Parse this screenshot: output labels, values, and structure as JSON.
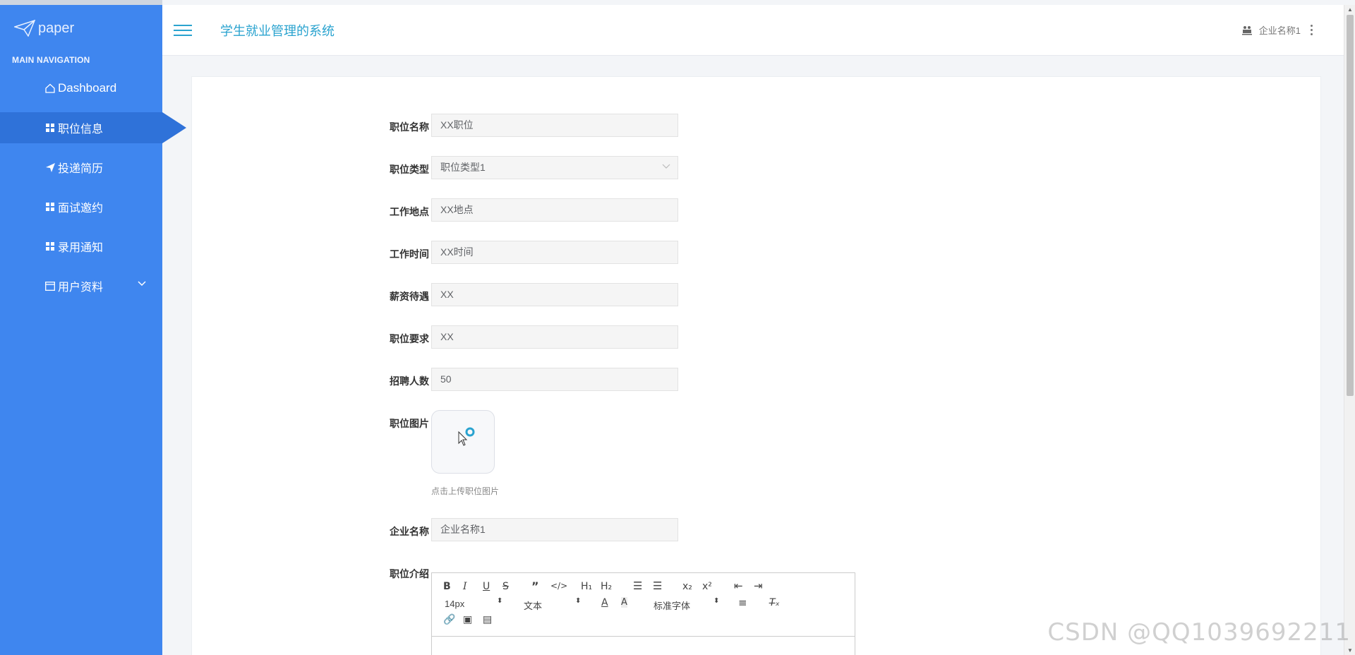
{
  "sidebar": {
    "logo_text": "paper",
    "nav_header": "MAIN NAVIGATION",
    "items": [
      {
        "label": "Dashboard",
        "icon": "home-icon"
      },
      {
        "label": "职位信息",
        "icon": "grid-icon"
      },
      {
        "label": "投递简历",
        "icon": "paper-plane-icon"
      },
      {
        "label": "面试邀约",
        "icon": "grid-icon"
      },
      {
        "label": "录用通知",
        "icon": "grid-icon"
      },
      {
        "label": "用户资料",
        "icon": "calendar-icon"
      }
    ]
  },
  "header": {
    "title": "学生就业管理的系统",
    "user_name": "企业名称1"
  },
  "form": {
    "fields": [
      {
        "label": "职位名称",
        "value": "XX职位"
      },
      {
        "label": "职位类型",
        "value": "职位类型1"
      },
      {
        "label": "工作地点",
        "value": "XX地点"
      },
      {
        "label": "工作时间",
        "value": "XX时间"
      },
      {
        "label": "薪资待遇",
        "value": "XX"
      },
      {
        "label": "职位要求",
        "value": "XX"
      },
      {
        "label": "招聘人数",
        "value": "50"
      }
    ],
    "image_label": "职位图片",
    "image_hint": "点击上传职位图片",
    "company_label": "企业名称",
    "company_value": "企业名称1",
    "intro_label": "职位介绍"
  },
  "editor": {
    "font_size": "14px",
    "heading_select": "文本",
    "font_family_select": "标准字体"
  },
  "watermark": "CSDN @QQ1039692211",
  "colors": {
    "sidebar": "#3f86ef",
    "sidebar_active": "#2f72d9",
    "accent": "#2aa3cf"
  }
}
